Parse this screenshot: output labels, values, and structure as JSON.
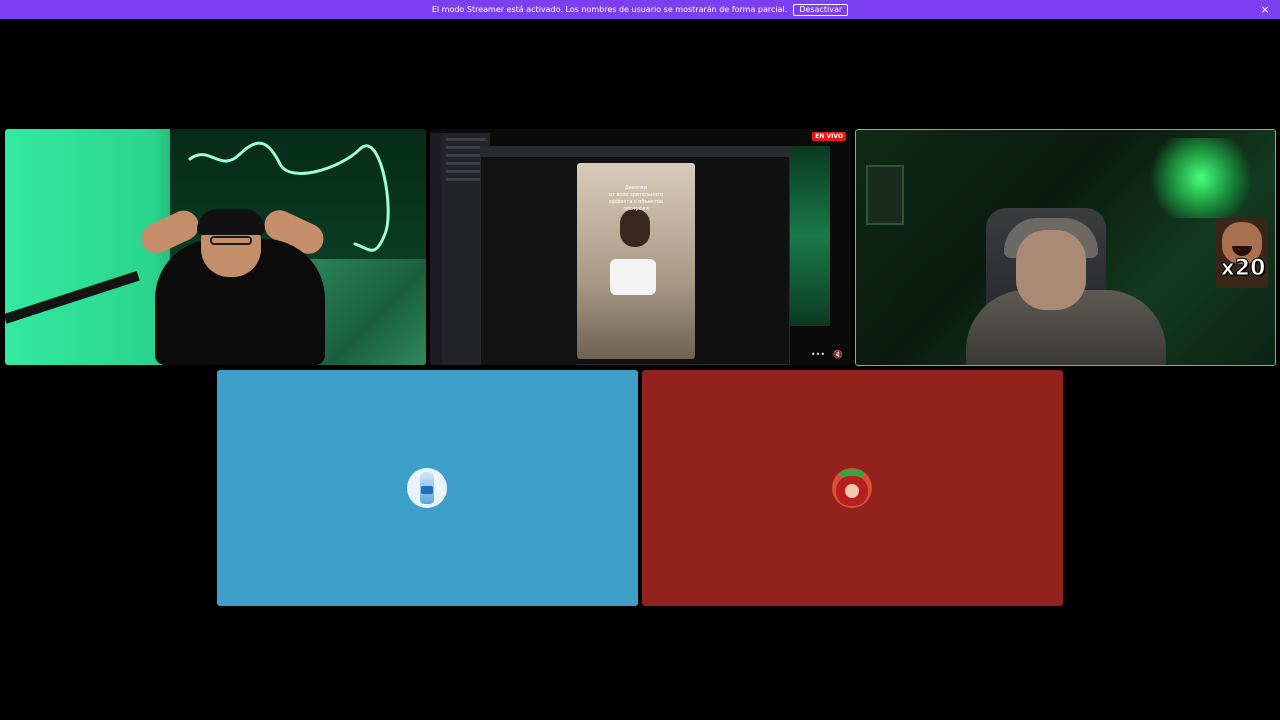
{
  "banner": {
    "message": "El modo Streamer está activado. Los nombres de usuario se mostrarán de forma parcial.",
    "deactivate_label": "Desactivar",
    "close_glyph": "×",
    "color": "#7b3ff0"
  },
  "tiles": {
    "screen_share": {
      "live_badge": "EN VIVO",
      "video_caption": "Девочки\nот всех зрительного\nэффекта с объектов\nсмотрели",
      "controls": [
        "•••",
        "🔇"
      ]
    },
    "webcam_right": {
      "overlay_text": "x20",
      "border_color": "#3ed57f"
    },
    "audio_blue": {
      "color": "#3ea0c8"
    },
    "audio_red": {
      "color": "#92231c"
    }
  }
}
